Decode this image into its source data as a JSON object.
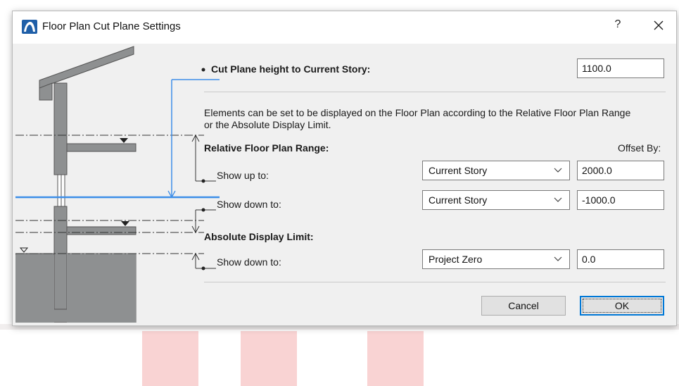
{
  "dialog": {
    "title": "Floor Plan Cut Plane Settings",
    "help_label": "?",
    "close_label": "close",
    "app_icon": "archicad-icon"
  },
  "cut_plane": {
    "label": "Cut Plane height to Current Story:",
    "value": "1100.0"
  },
  "description": {
    "line1": "Elements can be set to be displayed on the Floor Plan according to the Relative Floor Plan Range",
    "line2": "or the Absolute Display Limit."
  },
  "relative_range": {
    "heading": "Relative Floor Plan Range:",
    "offset_header": "Offset By:",
    "up": {
      "label": "Show up to:",
      "select": "Current Story",
      "offset": "2000.0"
    },
    "down": {
      "label": "Show down to:",
      "select": "Current Story",
      "offset": "-1000.0"
    }
  },
  "absolute_limit": {
    "heading": "Absolute Display Limit:",
    "down": {
      "label": "Show down to:",
      "select": "Project Zero",
      "offset": "0.0"
    }
  },
  "buttons": {
    "cancel": "Cancel",
    "ok": "OK"
  },
  "colors": {
    "accent_blue": "#3d8ee8",
    "dialog_bg": "#f0f0f0",
    "diagram_wall": "#8e9091",
    "ok_border": "#0078d7"
  }
}
